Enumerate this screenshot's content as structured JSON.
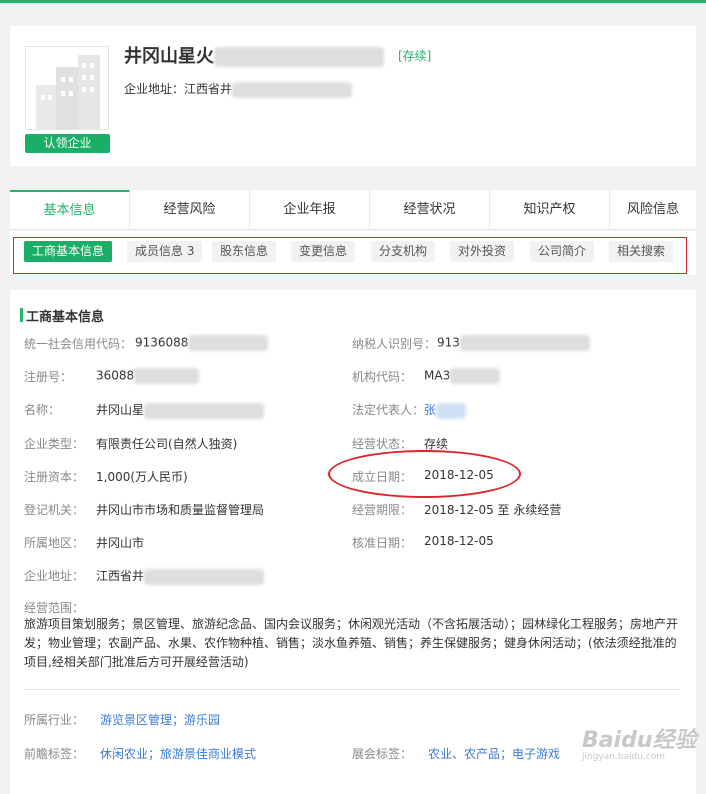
{
  "company": {
    "name": "井冈山星火",
    "status": "[存续]",
    "claim_label": "认领企业",
    "address_label": "企业地址：",
    "address_value": "江西省井"
  },
  "nav": {
    "tabs": [
      "基本信息",
      "经营风险",
      "企业年报",
      "经营状况",
      "知识产权",
      "风险信息"
    ],
    "active": 0
  },
  "subtabs": {
    "items": [
      "工商基本信息",
      "成员信息 3",
      "股东信息",
      "变更信息",
      "分支机构",
      "对外投资",
      "公司简介",
      "相关搜索"
    ],
    "active": 0
  },
  "section": {
    "title": "工商基本信息"
  },
  "fields": {
    "credit_code": {
      "label": "统一社会信用代码：",
      "value": "9136088"
    },
    "taxpayer_id": {
      "label": "纳税人识别号：",
      "value": "913"
    },
    "reg_no": {
      "label": "注册号：",
      "value": "36088"
    },
    "org_code": {
      "label": "机构代码：",
      "value": "MA3"
    },
    "name": {
      "label": "名称：",
      "value": "井冈山星"
    },
    "legal_rep": {
      "label": "法定代表人：",
      "value": "张"
    },
    "company_type": {
      "label": "企业类型：",
      "value": "有限责任公司(自然人独资)"
    },
    "status": {
      "label": "经营状态：",
      "value": "存续"
    },
    "capital": {
      "label": "注册资本：",
      "value": "1,000(万人民币)"
    },
    "founded": {
      "label": "成立日期：",
      "value": "2018-12-05"
    },
    "registrar": {
      "label": "登记机关：",
      "value": "井冈山市市场和质量监督管理局"
    },
    "term": {
      "label": "经营期限：",
      "value": "2018-12-05 至 永续经营"
    },
    "region": {
      "label": "所属地区：",
      "value": "井冈山市"
    },
    "approved": {
      "label": "核准日期：",
      "value": "2018-12-05"
    },
    "address": {
      "label": "企业地址：",
      "value": "江西省井"
    }
  },
  "scope": {
    "label": "经营范围：",
    "text": "旅游项目策划服务；景区管理、旅游纪念品、国内会议服务；休闲观光活动（不含拓展活动）；园林绿化工程服务；房地产开发；物业管理；农副产品、水果、农作物种植、销售；淡水鱼养殖、销售；养生保健服务；健身休闲活动；(依法须经批准的项目,经相关部门批准后方可开展经营活动)"
  },
  "industry": {
    "label": "所属行业：",
    "value": "游览景区管理；游乐园"
  },
  "forward_tags": {
    "label": "前瞻标签：",
    "value": "休闲农业；旅游景佳商业模式"
  },
  "exhibit_tags": {
    "label": "展会标签：",
    "value": "农业、农产品；电子游戏"
  },
  "watermark": {
    "big": "Baidu经验",
    "small": "jingyan.baidu.com"
  },
  "colors": {
    "accent": "#26b36b",
    "highlight": "#d9262c",
    "link": "#3a7bd5"
  }
}
